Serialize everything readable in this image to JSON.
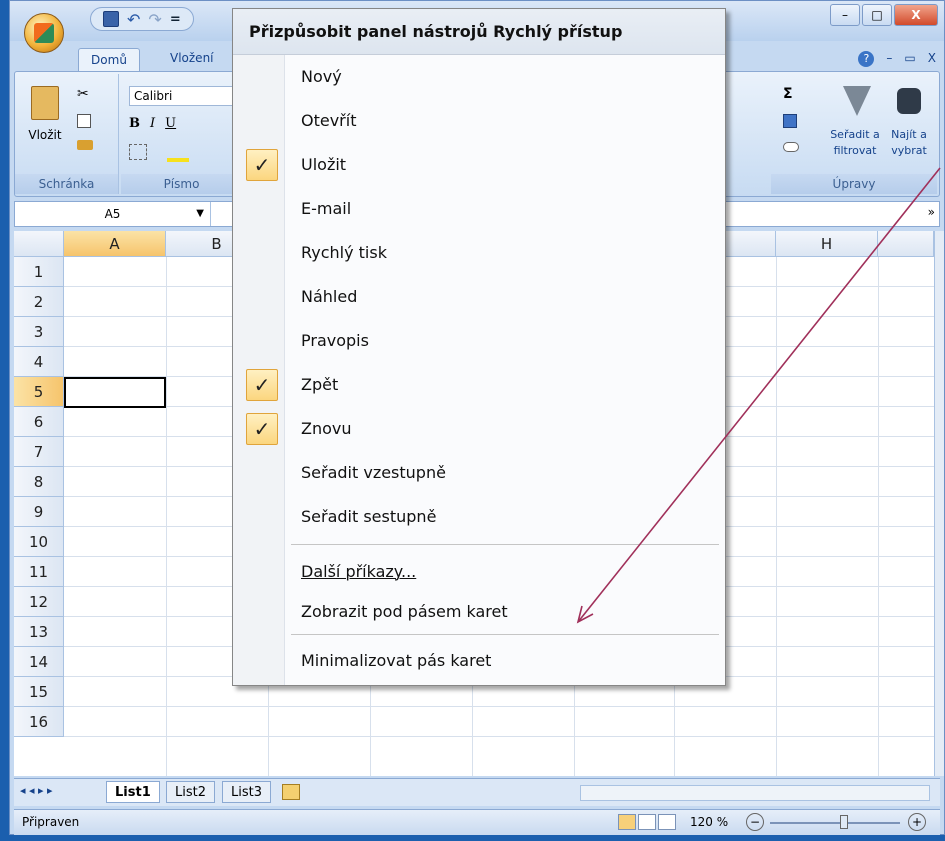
{
  "window": {
    "minimize": "–",
    "maximize": "□",
    "close": "X"
  },
  "qat": {
    "save_icon": "save-icon",
    "undo": "↶",
    "redo": "↷",
    "customize": "="
  },
  "tabs": {
    "home": "Domů",
    "insert": "Vložení"
  },
  "help": {
    "help_icon": "?",
    "min": "–",
    "restore": "▭",
    "close": "X"
  },
  "ribbon": {
    "paste_label": "Vložit",
    "clipboard_group": "Schránka",
    "font_name": "Calibri",
    "font_group": "Písmo",
    "bold": "B",
    "italic": "I",
    "underline": "U",
    "sum": "Σ",
    "sort_label1": "Seřadit a",
    "sort_label2": "filtrovat",
    "find_label1": "Najít a",
    "find_label2": "vybrat",
    "editing_group": "Úpravy"
  },
  "namebox": {
    "value": "A5"
  },
  "columns": [
    "A",
    "B",
    "H"
  ],
  "rows": [
    "1",
    "2",
    "3",
    "4",
    "5",
    "6",
    "7",
    "8",
    "9",
    "10",
    "11",
    "12",
    "13",
    "14",
    "15",
    "16"
  ],
  "menu": {
    "title": "Přizpůsobit panel nástrojů Rychlý přístup",
    "check": "✓",
    "items": [
      {
        "label": "Nový",
        "checked": false
      },
      {
        "label": "Otevřít",
        "checked": false
      },
      {
        "label": "Uložit",
        "checked": true
      },
      {
        "label": "E-mail",
        "checked": false
      },
      {
        "label": "Rychlý tisk",
        "checked": false
      },
      {
        "label": "Náhled",
        "checked": false
      },
      {
        "label": "Pravopis",
        "checked": false
      },
      {
        "label": "Zpět",
        "checked": true
      },
      {
        "label": "Znovu",
        "checked": true
      },
      {
        "label": "Seřadit vzestupně",
        "checked": false
      },
      {
        "label": "Seřadit sestupně",
        "checked": false
      }
    ],
    "more_commands": "Další příkazy...",
    "show_below": "Zobrazit pod pásem karet",
    "minimize_ribbon": "Minimalizovat pás karet"
  },
  "sheets": {
    "tabs": [
      "List1",
      "List2",
      "List3"
    ],
    "nav": "◂ ◂ ▸ ▸"
  },
  "status": {
    "ready": "Připraven",
    "zoom": "120 %",
    "zoom_out": "−",
    "zoom_in": "+"
  },
  "colors": {
    "accent": "#a0305a",
    "check_bg": "#fbd67f"
  }
}
